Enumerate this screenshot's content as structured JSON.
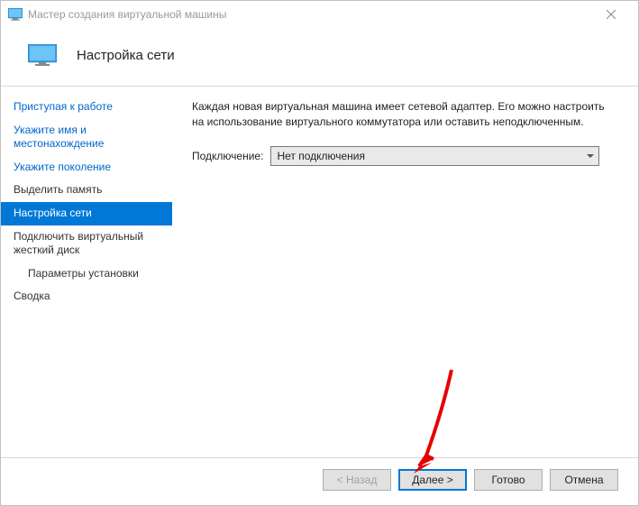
{
  "window": {
    "title": "Мастер создания виртуальной машины"
  },
  "header": {
    "title": "Настройка сети"
  },
  "sidebar": {
    "items": [
      {
        "label": "Приступая к работе"
      },
      {
        "label": "Укажите имя и местонахождение"
      },
      {
        "label": "Укажите поколение"
      },
      {
        "label": "Выделить память"
      },
      {
        "label": "Настройка сети"
      },
      {
        "label": "Подключить виртуальный жесткий диск"
      },
      {
        "label": "Параметры установки"
      },
      {
        "label": "Сводка"
      }
    ]
  },
  "main": {
    "description": "Каждая новая виртуальная машина имеет сетевой адаптер. Его можно настроить на использование виртуального коммутатора или оставить неподключенным.",
    "connection_label": "Подключение:",
    "connection_value": "Нет подключения"
  },
  "footer": {
    "back": "< Назад",
    "next": "Далее >",
    "finish": "Готово",
    "cancel": "Отмена"
  }
}
